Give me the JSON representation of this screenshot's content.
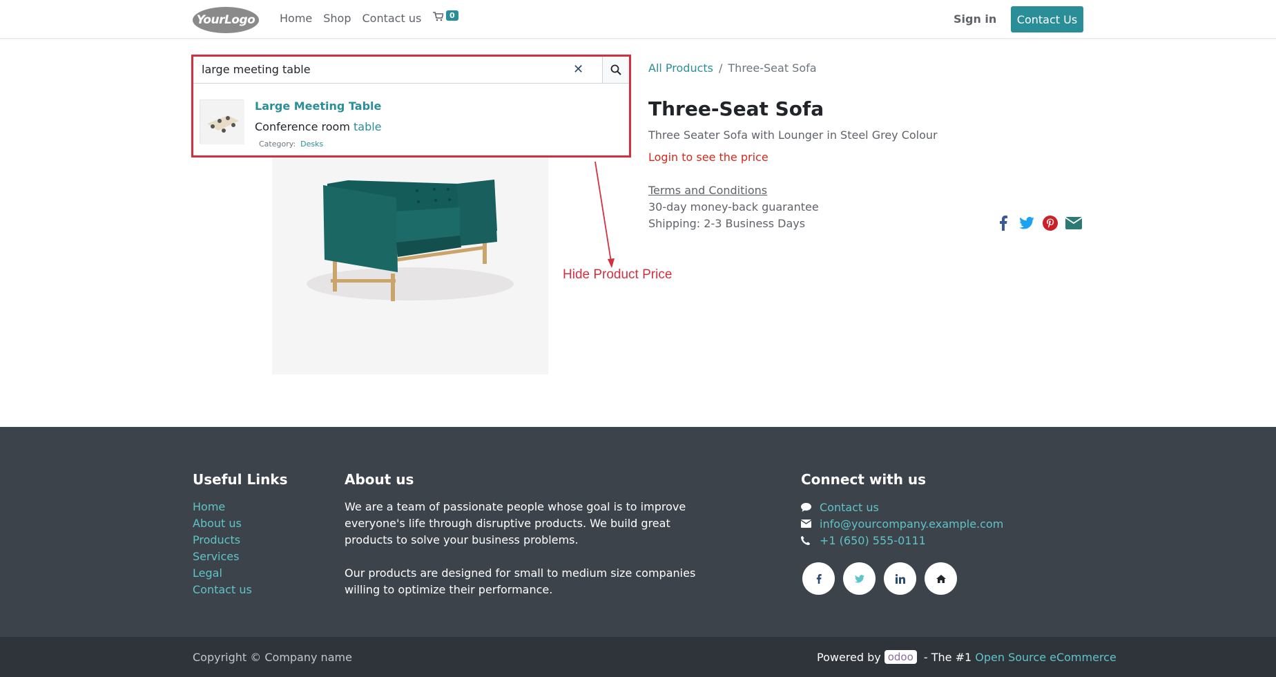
{
  "header": {
    "logo_text": "YourLogo",
    "nav": [
      "Home",
      "Shop",
      "Contact us"
    ],
    "cart_count": "0",
    "sign_in": "Sign in",
    "contact_button": "Contact Us"
  },
  "search": {
    "value": "large meeting table",
    "clear_icon": "close-icon",
    "search_icon": "search-icon",
    "result": {
      "title": "Large Meeting Table",
      "desc_prefix": "Conference room ",
      "desc_highlight": "table",
      "category_label": "Category:",
      "category_value": "Desks"
    }
  },
  "breadcrumb": {
    "root": "All Products",
    "separator": "/",
    "current": "Three-Seat Sofa"
  },
  "product": {
    "title": "Three-Seat Sofa",
    "subtitle": "Three Seater Sofa with Lounger in Steel Grey Colour",
    "login_price": "Login to see the price",
    "terms": "Terms and Conditions",
    "guarantee": "30-day money-back guarantee",
    "shipping": "Shipping: 2-3 Business Days"
  },
  "annotation": {
    "text": "Hide Product Price",
    "color": "#d32f3e"
  },
  "footer": {
    "useful_links_title": "Useful Links",
    "useful_links": [
      "Home",
      "About us",
      "Products",
      "Services",
      "Legal",
      "Contact us"
    ],
    "about_title": "About us",
    "about_p1": "We are a team of passionate people whose goal is to improve everyone's life through disruptive products. We build great products to solve your business problems.",
    "about_p2": "Our products are designed for small to medium size companies willing to optimize their performance.",
    "connect_title": "Connect with us",
    "connect_contact": "Contact us",
    "connect_email": "info@yourcompany.example.com",
    "connect_phone": "+1 (650) 555-0111",
    "social_icons": [
      "facebook-icon",
      "twitter-icon",
      "linkedin-icon",
      "home-icon"
    ]
  },
  "bottom": {
    "copyright": "Copyright © Company name",
    "powered_by": "Powered by",
    "odoo": "odoo",
    "tagline": " - The #1 ",
    "link": "Open Source eCommerce"
  },
  "colors": {
    "accent": "#2a8e99",
    "footer_bg": "#3d434b",
    "price_login": "#d3291b",
    "highlight_border": "#d32f3e"
  }
}
